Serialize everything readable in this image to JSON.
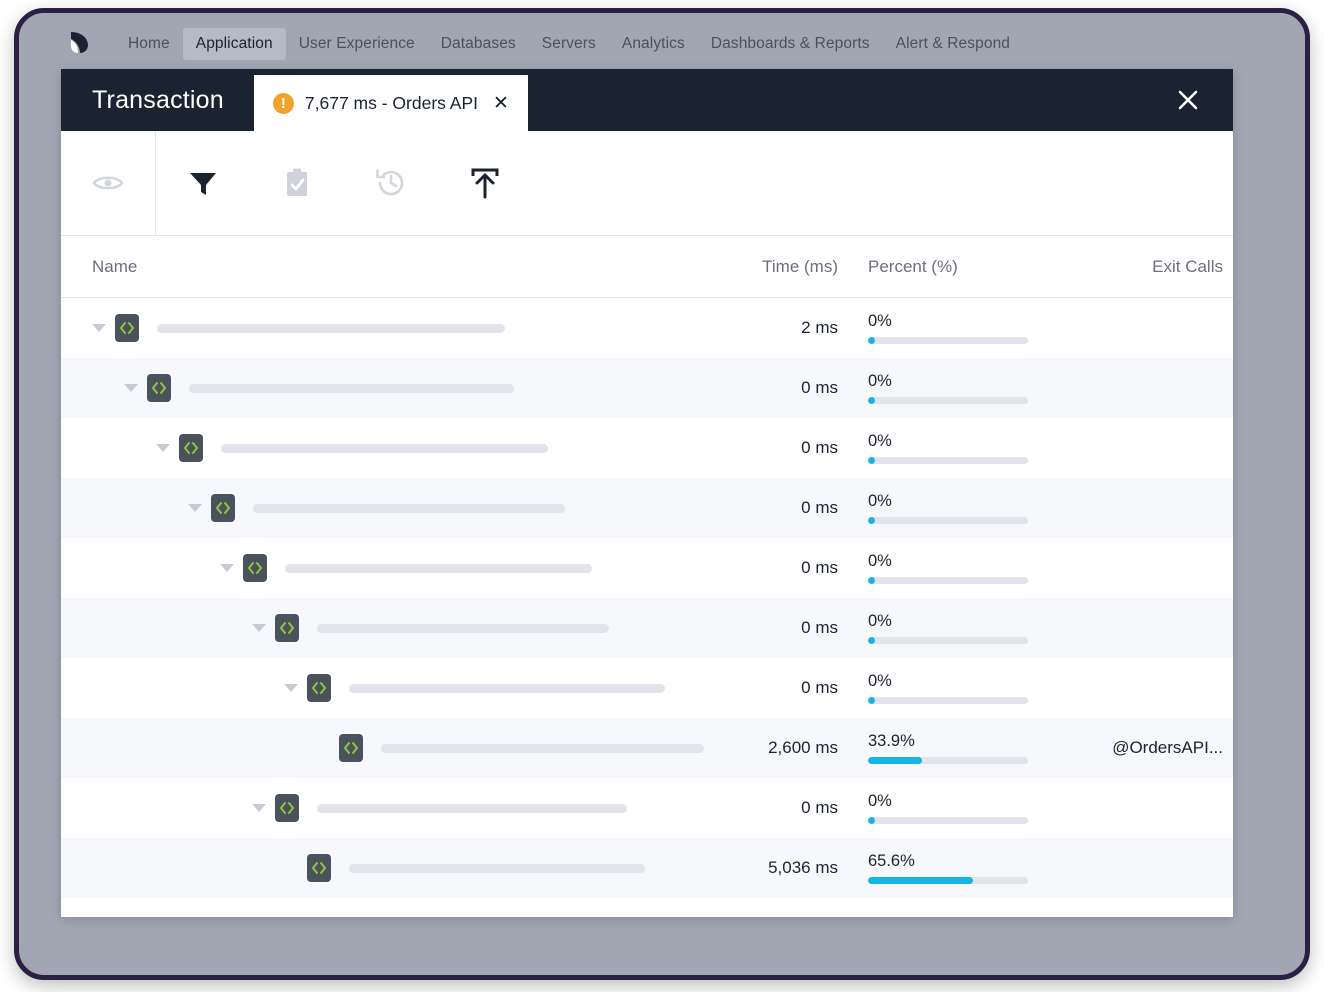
{
  "nav": {
    "logo_icon": "appdynamics-logo-icon",
    "items": [
      {
        "label": "Home",
        "active": false
      },
      {
        "label": "Application",
        "active": true
      },
      {
        "label": "User Experience",
        "active": false
      },
      {
        "label": "Databases",
        "active": false
      },
      {
        "label": "Servers",
        "active": false
      },
      {
        "label": "Analytics",
        "active": false
      },
      {
        "label": "Dashboards & Reports",
        "active": false
      },
      {
        "label": "Alert & Respond",
        "active": false
      }
    ]
  },
  "panel": {
    "title": "Transaction",
    "tab": {
      "label": "7,677 ms - Orders API",
      "warning_icon": "warning-exclamation-icon",
      "close_label": "✕"
    },
    "close_label": "✕"
  },
  "toolbar": {
    "buttons": [
      {
        "icon": "eye-icon",
        "enabled": false
      },
      {
        "icon": "filter-icon",
        "enabled": true
      },
      {
        "icon": "clipboard-check-icon",
        "enabled": false
      },
      {
        "icon": "history-icon",
        "enabled": false
      },
      {
        "icon": "export-upload-icon",
        "enabled": true
      }
    ]
  },
  "table": {
    "columns": {
      "name": "Name",
      "time": "Time (ms)",
      "percent": "Percent (%)",
      "exit": "Exit Calls"
    },
    "rows": [
      {
        "depth": 0,
        "expandable": true,
        "time": "2 ms",
        "percent": "0%",
        "percent_value": 0,
        "bar": 348,
        "exit": ""
      },
      {
        "depth": 1,
        "expandable": true,
        "time": "0 ms",
        "percent": "0%",
        "percent_value": 0,
        "bar": 325,
        "exit": ""
      },
      {
        "depth": 2,
        "expandable": true,
        "time": "0 ms",
        "percent": "0%",
        "percent_value": 0,
        "bar": 327,
        "exit": ""
      },
      {
        "depth": 3,
        "expandable": true,
        "time": "0 ms",
        "percent": "0%",
        "percent_value": 0,
        "bar": 312,
        "exit": ""
      },
      {
        "depth": 4,
        "expandable": true,
        "time": "0 ms",
        "percent": "0%",
        "percent_value": 0,
        "bar": 307,
        "exit": ""
      },
      {
        "depth": 5,
        "expandable": true,
        "time": "0 ms",
        "percent": "0%",
        "percent_value": 0,
        "bar": 292,
        "exit": ""
      },
      {
        "depth": 6,
        "expandable": true,
        "time": "0 ms",
        "percent": "0%",
        "percent_value": 0,
        "bar": 316,
        "exit": ""
      },
      {
        "depth": 7,
        "expandable": false,
        "time": "2,600 ms",
        "percent": "33.9%",
        "percent_value": 33.9,
        "bar": 323,
        "exit": "@OrdersAPI..."
      },
      {
        "depth": 5,
        "expandable": true,
        "time": "0 ms",
        "percent": "0%",
        "percent_value": 0,
        "bar": 310,
        "exit": ""
      },
      {
        "depth": 6,
        "expandable": false,
        "time": "5,036 ms",
        "percent": "65.6%",
        "percent_value": 65.6,
        "bar": 296,
        "exit": ""
      }
    ]
  },
  "colors": {
    "accent_bar": "#16b5e8",
    "header_dark": "#1b2230",
    "warning_orange": "#f2a32b",
    "code_icon_bg": "#4c515e",
    "code_icon_fg": "#8fc63f",
    "frame_gray": "#a2a6b2",
    "frame_border": "#2b1f44"
  }
}
